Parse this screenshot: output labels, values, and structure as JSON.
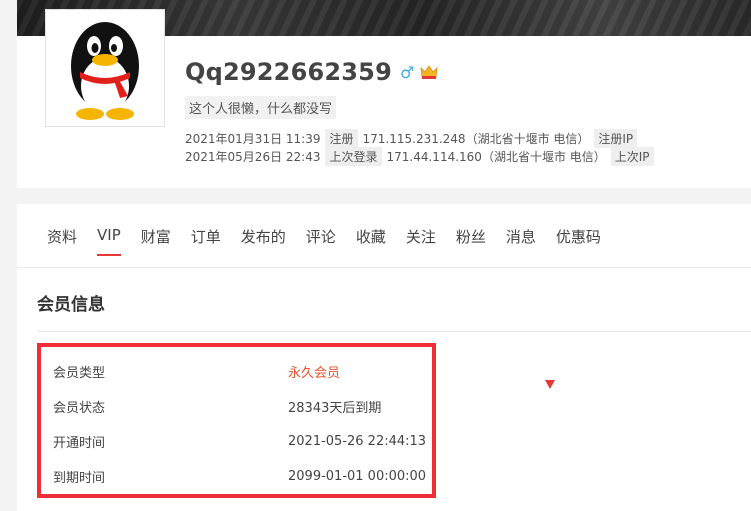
{
  "profile": {
    "username": "Qq2922662359",
    "gender_symbol": "♂",
    "bio": "这个人很懒，什么都没写",
    "register": {
      "time": "2021年01月31日 11:39",
      "action": "注册",
      "ip": "171.115.231.248",
      "location": "（湖北省十堰市 电信）",
      "ip_label": "注册IP"
    },
    "last_login": {
      "time": "2021年05月26日 22:43",
      "action": "上次登录",
      "ip": "171.44.114.160",
      "location": "（湖北省十堰市 电信）",
      "ip_label": "上次IP"
    }
  },
  "tabs": [
    {
      "label": "资料",
      "active": false
    },
    {
      "label": "VIP",
      "active": true
    },
    {
      "label": "财富",
      "active": false
    },
    {
      "label": "订单",
      "active": false
    },
    {
      "label": "发布的",
      "active": false
    },
    {
      "label": "评论",
      "active": false
    },
    {
      "label": "收藏",
      "active": false
    },
    {
      "label": "关注",
      "active": false
    },
    {
      "label": "粉丝",
      "active": false
    },
    {
      "label": "消息",
      "active": false
    },
    {
      "label": "优惠码",
      "active": false
    }
  ],
  "section": {
    "title": "会员信息"
  },
  "vip_info": [
    {
      "key": "会员类型",
      "value": "永久会员"
    },
    {
      "key": "会员状态",
      "value": "28343天后到期"
    },
    {
      "key": "开通时间",
      "value": "2021-05-26 22:44:13"
    },
    {
      "key": "到期时间",
      "value": "2099-01-01 00:00:00"
    }
  ],
  "colors": {
    "accent": "#e53935",
    "vip_highlight": "#e5532f",
    "highlight_border": "#ef2f35",
    "gender": "#3fa9e0"
  }
}
